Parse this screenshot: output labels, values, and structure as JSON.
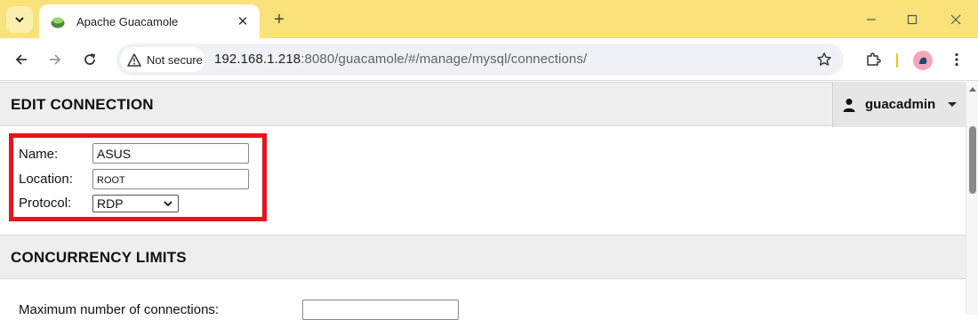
{
  "browser": {
    "tab": {
      "title": "Apache Guacamole",
      "close_symbol": "✕"
    },
    "new_tab_symbol": "+",
    "security_label": "Not secure",
    "url_host": "192.168.1.218",
    "url_rest": ":8080/guacamole/#/manage/mysql/connections/",
    "accent_color": "#f9e27a"
  },
  "header": {
    "title": "EDIT CONNECTION",
    "user": {
      "name": "guacadmin",
      "icon": "user-icon"
    }
  },
  "connection_form": {
    "highlight_color": "#e8141b",
    "name": {
      "label": "Name:",
      "value": "ASUS"
    },
    "location": {
      "label": "Location:",
      "value": "ROOT"
    },
    "protocol": {
      "label": "Protocol:",
      "value": "RDP"
    }
  },
  "concurrency": {
    "title": "CONCURRENCY LIMITS",
    "max_connections": {
      "label": "Maximum number of connections:",
      "value": ""
    }
  }
}
